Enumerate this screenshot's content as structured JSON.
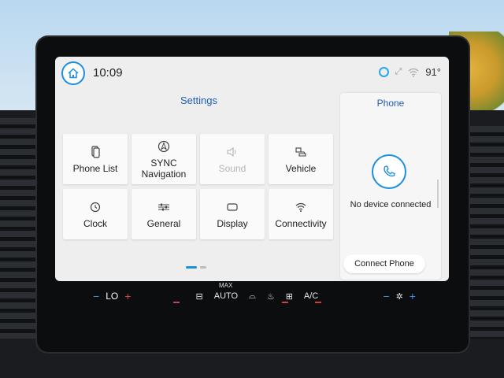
{
  "status_bar": {
    "time": "10:09",
    "temperature": "91°",
    "icons": [
      "home-icon",
      "alexa-icon",
      "phone-signal-icon",
      "wifi-icon"
    ]
  },
  "settings": {
    "title": "Settings",
    "tiles": [
      {
        "label": "Phone List",
        "icon": "phone-list-icon",
        "enabled": true
      },
      {
        "label": "SYNC Navigation",
        "icon": "navigation-icon",
        "enabled": true
      },
      {
        "label": "Sound",
        "icon": "speaker-icon",
        "enabled": false
      },
      {
        "label": "Vehicle",
        "icon": "vehicle-icon",
        "enabled": true
      },
      {
        "label": "Clock",
        "icon": "clock-icon",
        "enabled": true
      },
      {
        "label": "General",
        "icon": "sliders-icon",
        "enabled": true
      },
      {
        "label": "Display",
        "icon": "display-icon",
        "enabled": true
      },
      {
        "label": "Connectivity",
        "icon": "wifi-icon",
        "enabled": true
      }
    ],
    "page_count": 2,
    "current_page": 1
  },
  "phone": {
    "title": "Phone",
    "status": "No device connected",
    "connect_label": "Connect Phone"
  },
  "climate": {
    "left_temp": "LO",
    "auto_label": "AUTO",
    "max_label": "MAX",
    "ac_label": "A/C"
  },
  "colors": {
    "accent": "#1d8fe0",
    "title_blue": "#1d5fb8",
    "screen_bg": "#eeeeee"
  }
}
